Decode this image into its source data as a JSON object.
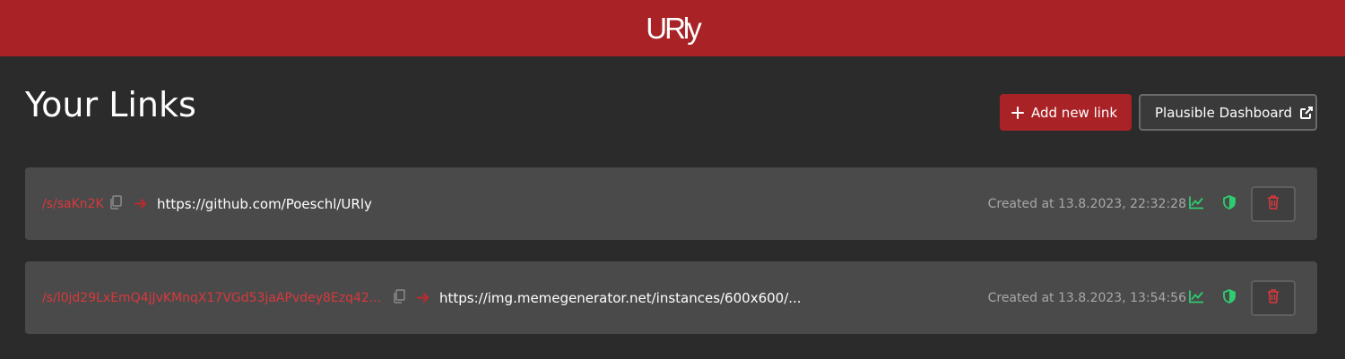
{
  "app": {
    "logo": "URly"
  },
  "page": {
    "title": "Your Links"
  },
  "toolbar": {
    "add_label": "Add new link",
    "dashboard_label": "Plausible Dashboard"
  },
  "links": [
    {
      "short": "/s/saKn2K",
      "target": "https://github.com/Poeschl/URly",
      "created": "Created at 13.8.2023, 22:32:28"
    },
    {
      "short": "/s/l0jd29LxEmQ4jJvKMnqX17VGd53jaAPvdey8Ezq42...",
      "target": "https://img.memegenerator.net/instances/600x600/...",
      "created": "Created at 13.8.2023, 13:54:56"
    }
  ],
  "icons": {
    "plus": "plus-icon",
    "external": "external-link-icon",
    "copy": "copy-icon",
    "arrow": "arrow-right-icon",
    "stats": "chart-line-icon",
    "shield": "shield-icon",
    "trash": "trash-icon"
  },
  "colors": {
    "brand": "#a92226",
    "background": "#2b2b2b",
    "card": "#4a4a4a",
    "short_link": "#d9383c",
    "success": "#2ecc71",
    "muted": "#a8a8a8"
  }
}
